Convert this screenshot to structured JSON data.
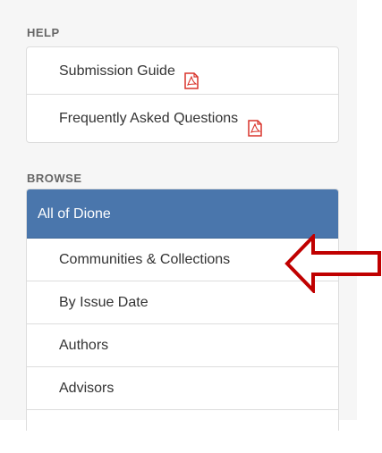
{
  "help": {
    "title": "HELP",
    "items": [
      {
        "label": "Submission Guide",
        "icon": "pdf-icon"
      },
      {
        "label": "Frequently Asked Questions",
        "icon": "pdf-icon"
      }
    ]
  },
  "browse": {
    "title": "BROWSE",
    "active_label": "All of Dione",
    "items": [
      {
        "label": "Communities & Collections"
      },
      {
        "label": "By Issue Date"
      },
      {
        "label": "Authors"
      },
      {
        "label": "Advisors"
      }
    ]
  },
  "colors": {
    "active_bg": "#4a76ac",
    "arrow": "#c00000",
    "pdf_icon": "#d9342b"
  }
}
